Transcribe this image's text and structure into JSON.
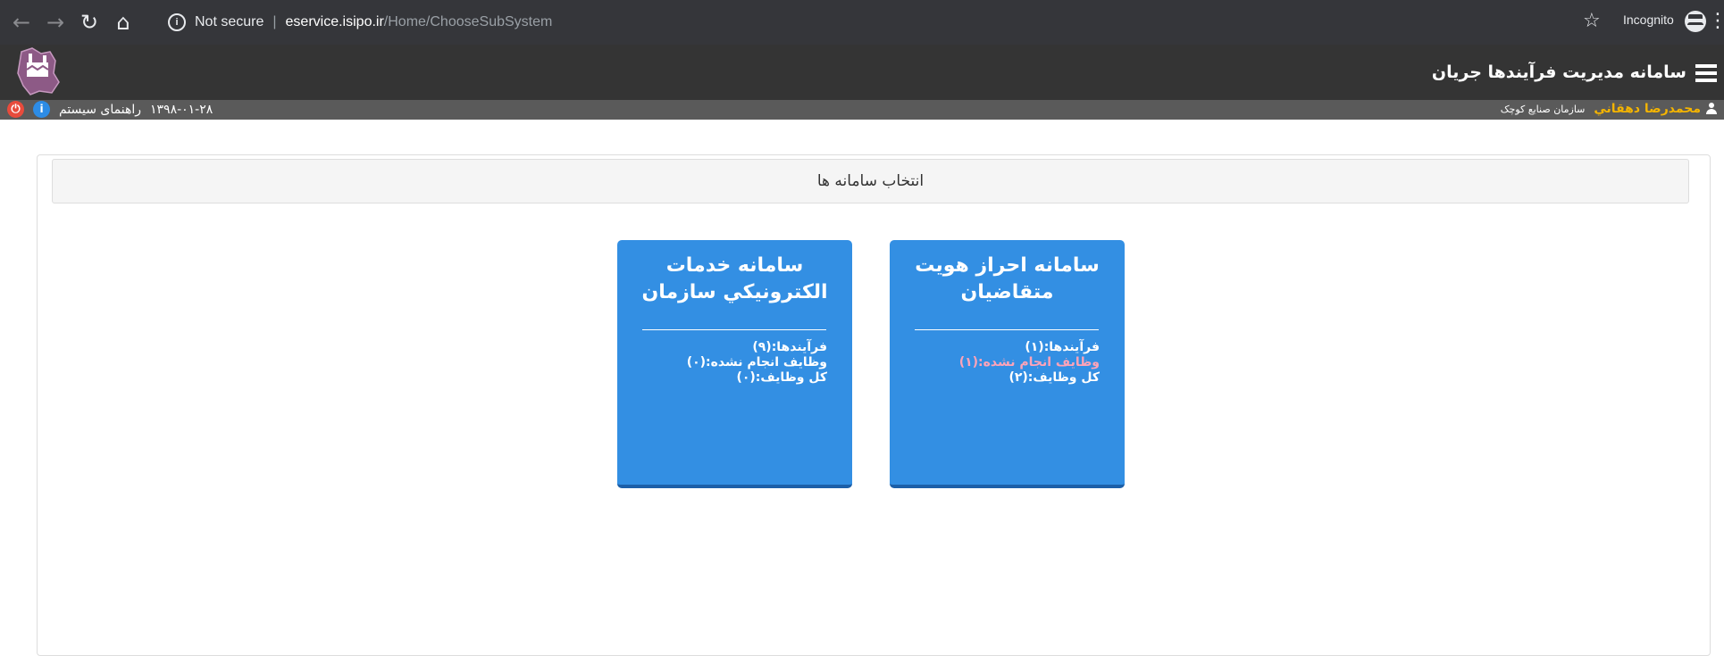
{
  "browser": {
    "security_label": "Not secure",
    "url_host": "eservice.isipo.ir",
    "url_path": "/Home/ChooseSubSystem",
    "incognito_label": "Incognito"
  },
  "header": {
    "title": "سامانه مدیریت فرآیندها جریان",
    "user_name": "محمدرضا دهقاني",
    "organization": "سازمان صنایع کوچک",
    "date": "۱۳۹۸-۰۱-۲۸",
    "help_label": "راهنمای سیستم"
  },
  "panel": {
    "title": "انتخاب سامانه ها"
  },
  "cards": [
    {
      "title_line1": "سامانه احراز هويت",
      "title_line2": "متقاضيان",
      "processes": "فرآیندها:(۱)",
      "pending_tasks": "وظایف انجام نشده:(۱)",
      "total_tasks": "کل وظایف:(۲)"
    },
    {
      "title_line1": "سامانه خدمات",
      "title_line2": "الكترونيكي سازمان",
      "processes": "فرآیندها:(۹)",
      "pending_tasks": "وظایف انجام نشده:(۰)",
      "total_tasks": "کل وظایف:(۰)"
    }
  ],
  "colors": {
    "card_bg": "#338fe3",
    "alert_text": "#ffa3b8",
    "user_name": "#f4b400"
  }
}
